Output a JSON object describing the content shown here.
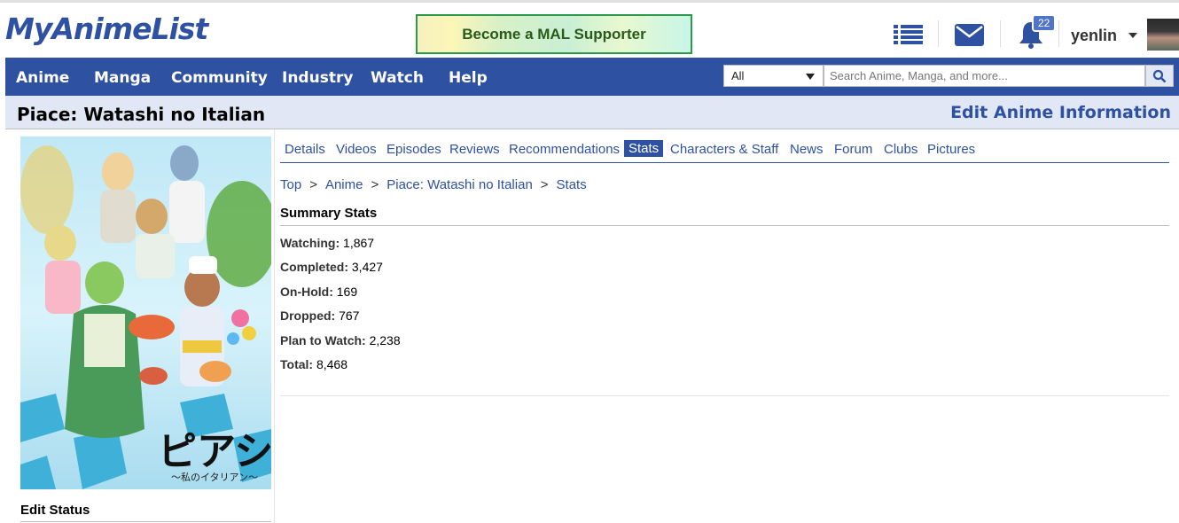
{
  "header": {
    "logo": "MyAnimeList",
    "supporter_banner": "Become a MAL Supporter",
    "notification_count": "22",
    "username": "yenlin"
  },
  "nav": {
    "items": [
      "Anime",
      "Manga",
      "Community",
      "Industry",
      "Watch",
      "Help"
    ],
    "search_select": "All",
    "search_placeholder": "Search Anime, Manga, and more..."
  },
  "title_bar": {
    "title": "Piace: Watashi no Italian",
    "edit_link": "Edit Anime Information"
  },
  "left": {
    "edit_status": "Edit Status"
  },
  "tabs": {
    "items": [
      "Details",
      "Videos",
      "Episodes",
      "Reviews",
      "Recommendations",
      "Stats",
      "Characters & Staff",
      "News",
      "Forum",
      "Clubs",
      "Pictures"
    ],
    "active": "Stats"
  },
  "breadcrumb": {
    "items": [
      "Top",
      "Anime",
      "Piace: Watashi no Italian",
      "Stats"
    ],
    "separator": ">"
  },
  "summary": {
    "title": "Summary Stats",
    "stats": [
      {
        "label": "Watching:",
        "value": "1,867"
      },
      {
        "label": "Completed:",
        "value": "3,427"
      },
      {
        "label": "On-Hold:",
        "value": "169"
      },
      {
        "label": "Dropped:",
        "value": "767"
      },
      {
        "label": "Plan to Watch:",
        "value": "2,238"
      },
      {
        "label": "Total:",
        "value": "8,468"
      }
    ]
  },
  "colors": {
    "brand_blue": "#2e51a2",
    "title_bar_bg": "#e1e7f5"
  }
}
